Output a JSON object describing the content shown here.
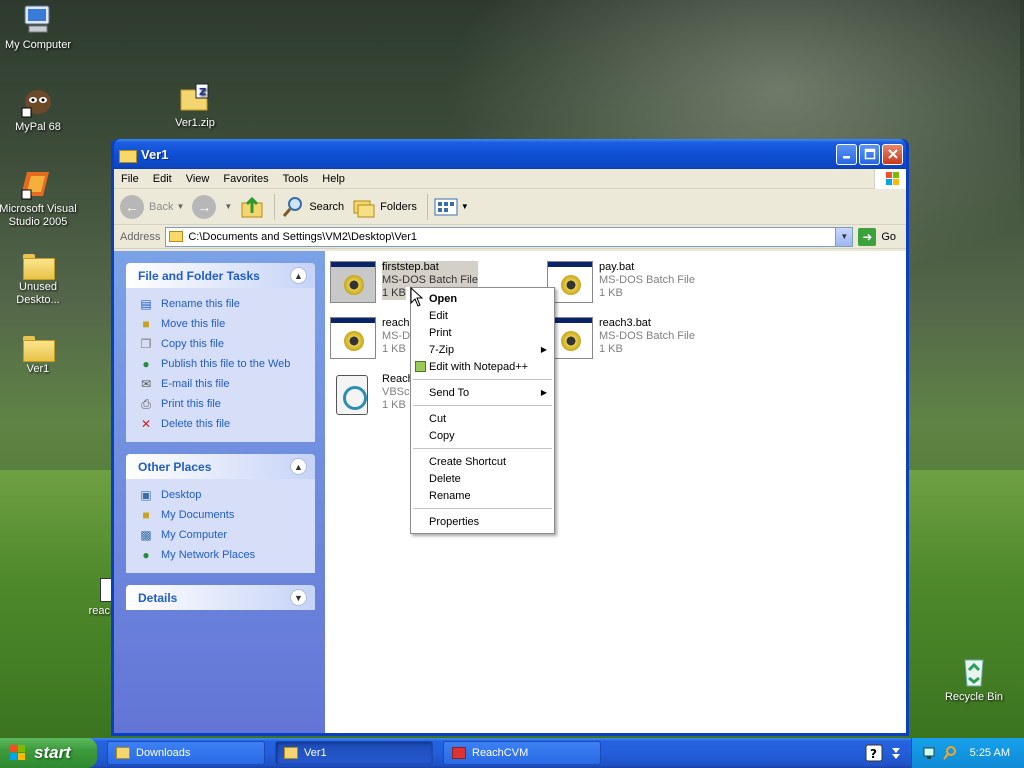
{
  "desktop": {
    "icons": [
      {
        "label": "My Computer"
      },
      {
        "label": "MyPal 68"
      },
      {
        "label": "Ver1.zip"
      },
      {
        "label": "Microsoft Visual Studio 2005"
      },
      {
        "label": "Unused Deskto..."
      },
      {
        "label": "Ver1"
      },
      {
        "label": "reac"
      },
      {
        "label": "Recycle Bin"
      }
    ]
  },
  "window": {
    "title": "Ver1",
    "menu": [
      "File",
      "Edit",
      "View",
      "Favorites",
      "Tools",
      "Help"
    ],
    "toolbar": {
      "back": "Back",
      "search": "Search",
      "folders": "Folders"
    },
    "address": {
      "label": "Address",
      "value": "C:\\Documents and Settings\\VM2\\Desktop\\Ver1",
      "go": "Go"
    }
  },
  "task_pane": {
    "file_folder_tasks": {
      "title": "File and Folder Tasks",
      "items": [
        "Rename this file",
        "Move this file",
        "Copy this file",
        "Publish this file to the Web",
        "E-mail this file",
        "Print this file",
        "Delete this file"
      ]
    },
    "other_places": {
      "title": "Other Places",
      "items": [
        "Desktop",
        "My Documents",
        "My Computer",
        "My Network Places"
      ]
    },
    "details": {
      "title": "Details"
    }
  },
  "files": [
    {
      "name": "firststep.bat",
      "type": "MS-DOS Batch File",
      "size": "1 KB",
      "selected": true
    },
    {
      "name": "pay.bat",
      "type": "MS-DOS Batch File",
      "size": "1 KB"
    },
    {
      "name": "reach",
      "type": "MS-Do",
      "size": "1 KB"
    },
    {
      "name": "reach3.bat",
      "type": "MS-DOS Batch File",
      "size": "1 KB"
    },
    {
      "name": "Reach",
      "type": "VBScr",
      "size": "1 KB"
    }
  ],
  "context_menu": {
    "open": "Open",
    "edit": "Edit",
    "print": "Print",
    "seven_zip": "7-Zip",
    "notepad": "Edit with Notepad++",
    "send_to": "Send To",
    "cut": "Cut",
    "copy": "Copy",
    "create_shortcut": "Create Shortcut",
    "delete": "Delete",
    "rename": "Rename",
    "properties": "Properties"
  },
  "taskbar": {
    "start": "start",
    "buttons": [
      {
        "label": "Downloads"
      },
      {
        "label": "Ver1",
        "active": true
      },
      {
        "label": "ReachCVM"
      }
    ],
    "clock": "5:25 AM"
  }
}
